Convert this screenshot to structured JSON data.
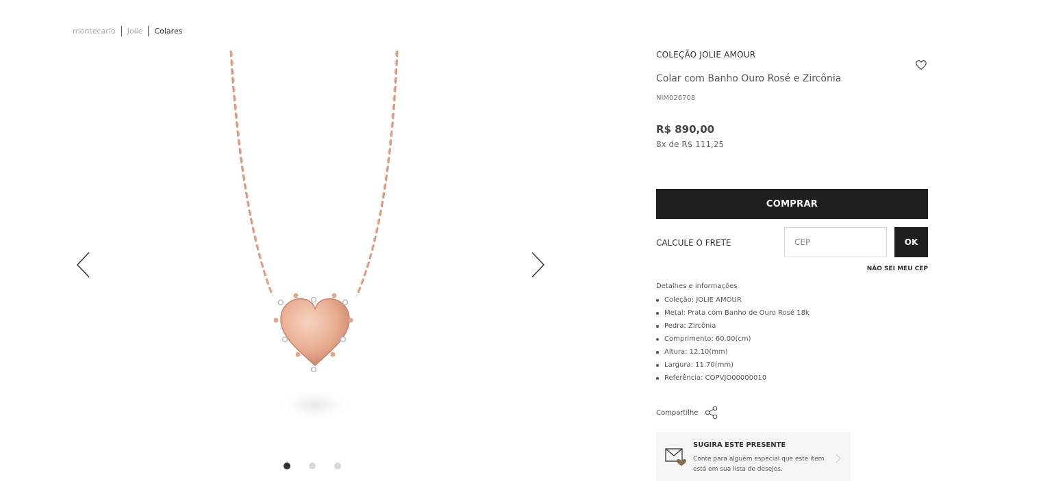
{
  "breadcrumb": [
    "montecarlo",
    "Jolie",
    "Colares"
  ],
  "product": {
    "collection": "COLEÇÃO JOLIE AMOUR",
    "name": "Colar com Banho Ouro Rosé e Zircônia",
    "sku": "NIM026708",
    "price": "R$ 890,00",
    "installments": "8x de R$ 111,25",
    "image_icon": "rose-gold-heart-necklace"
  },
  "gallery": {
    "slide_count": 3,
    "active_slide": 1
  },
  "actions": {
    "buy_label": "COMPRAR",
    "shipping_label": "CALCULE O FRETE",
    "cep_placeholder": "CEP",
    "ok_label": "OK",
    "no_cep_label": "NÃO SEI MEU CEP"
  },
  "details": {
    "title": "Detalhes e informações",
    "items": [
      "Coleção: JOLIE AMOUR",
      "Metal: Prata com Banho de Ouro Rosé 18k",
      "Pedra: Zircônia",
      "Comprimento: 60.00(cm)",
      "Altura: 12.10(mm)",
      "Largura: 11.70(mm)",
      "Referência: COPVJO00000010"
    ]
  },
  "share_label": "Compartilhe",
  "gift": {
    "title": "SUGIRA ESTE PRESENTE",
    "text": "Conte para alguém especial que este item está em sua lista de desejos."
  },
  "colors": {
    "dark_button": "#1e201f",
    "rose_gold": "#d9987c",
    "gift_bg": "#f5f5f5"
  }
}
